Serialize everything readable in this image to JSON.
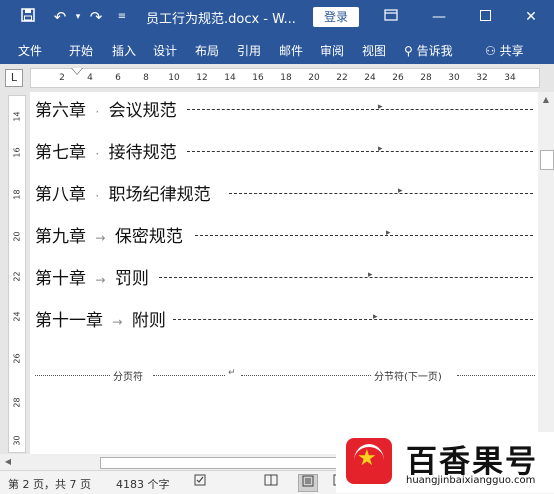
{
  "titlebar": {
    "save_icon": "save-icon",
    "undo_icon": "undo-icon",
    "redo_icon": "redo-icon",
    "customize_icon": "customize-qat-icon",
    "title": "员工行为规范.docx - W...",
    "login_label": "登录",
    "ribbon_display_icon": "ribbon-display-options-icon",
    "minimize_icon": "minimize-icon",
    "maximize_icon": "maximize-icon",
    "close_icon": "close-icon"
  },
  "ribbon": {
    "tabs": [
      "文件",
      "开始",
      "插入",
      "设计",
      "布局",
      "引用",
      "邮件",
      "审阅",
      "视图"
    ],
    "tell_me": "告诉我",
    "share": "共享"
  },
  "ruler": {
    "corner": "L",
    "h_ticks": [
      "2",
      "4",
      "6",
      "8",
      "10",
      "12",
      "14",
      "16",
      "18",
      "20",
      "22",
      "24",
      "26",
      "28",
      "30",
      "32",
      "34"
    ],
    "v_ticks": [
      "14",
      "16",
      "18",
      "20",
      "22",
      "24",
      "26",
      "28",
      "30"
    ]
  },
  "document": {
    "lines": [
      {
        "chapter": "第六章",
        "sep": "·",
        "title": "会议规范"
      },
      {
        "chapter": "第七章",
        "sep": "·",
        "title": "接待规范"
      },
      {
        "chapter": "第八章",
        "sep": "·",
        "title": "职场纪律规范"
      },
      {
        "chapter": "第九章",
        "sep": "→",
        "title": "保密规范"
      },
      {
        "chapter": "第十章",
        "sep": "→",
        "title": "罚则"
      },
      {
        "chapter": "第十一章",
        "sep": "→",
        "title": "附则"
      }
    ],
    "page_break_label": "分页符",
    "section_break_label": "分节符(下一页)"
  },
  "status": {
    "page": "第 2 页，共 7 页",
    "words": "4183 个字",
    "proofing_icon": "proofing-icon",
    "read_mode_icon": "read-mode-icon",
    "print_layout_icon": "print-layout-icon",
    "web_layout_icon": "web-layout-icon"
  },
  "watermark": {
    "title": "百香果号",
    "url": "huangjinbaixiangguo.com"
  },
  "colors": {
    "ribbon": "#2b579a",
    "logo": "#e3222b",
    "star": "#f7d21e"
  }
}
